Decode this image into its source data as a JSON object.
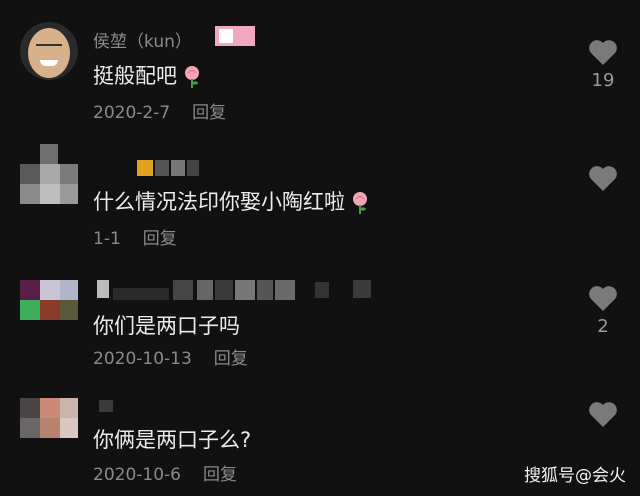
{
  "comments": [
    {
      "username": "侯堃（kun）",
      "text": "挺般配吧",
      "date": "2020-2-7",
      "reply": "回复",
      "likes": "19"
    },
    {
      "username": "",
      "text": "什么情况法印你娶小陶红啦",
      "date": "1-1",
      "reply": "回复",
      "likes": ""
    },
    {
      "username": "",
      "text": "你们是两口子吗",
      "date": "2020-10-13",
      "reply": "回复",
      "likes": "2"
    },
    {
      "username": "",
      "text": "你俩是两口子么?",
      "date": "2020-10-6",
      "reply": "回复",
      "likes": ""
    }
  ],
  "watermark": "搜狐号@会火",
  "colors": {
    "background": "#111111",
    "text": "#ececec",
    "meta": "#8a8a8a",
    "heart": "#7a7a7a",
    "badge": "#f2a7c0"
  },
  "icons": [
    "heart-icon",
    "rose-emoji-icon"
  ]
}
